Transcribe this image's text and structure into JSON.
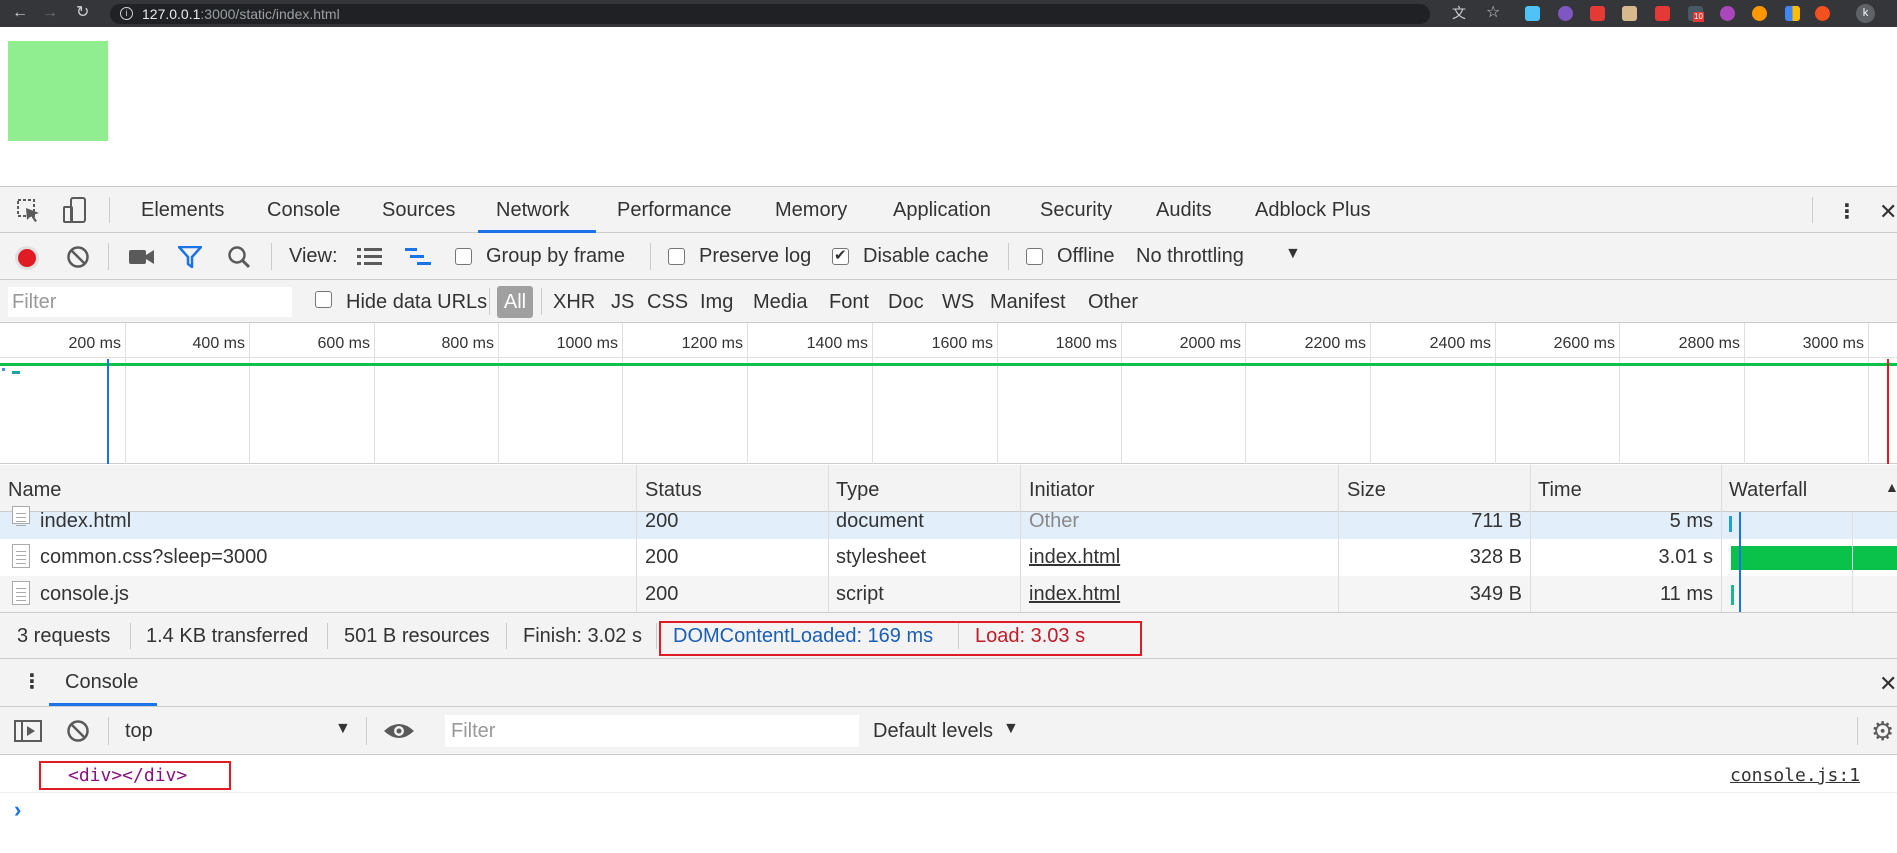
{
  "browser": {
    "url_host": "127.0.0.1",
    "url_path": ":3000/static/index.html",
    "profile_initial": "k",
    "extension_badge": "10"
  },
  "devtools": {
    "tabs": [
      "Elements",
      "Console",
      "Sources",
      "Network",
      "Performance",
      "Memory",
      "Application",
      "Security",
      "Audits",
      "Adblock Plus"
    ],
    "active_tab": "Network",
    "toolbar": {
      "view_label": "View:",
      "group_by_frame": "Group by frame",
      "preserve_log": "Preserve log",
      "disable_cache": "Disable cache",
      "offline": "Offline",
      "throttling": "No throttling"
    },
    "filterbar": {
      "placeholder": "Filter",
      "hide_data_urls": "Hide data URLs",
      "types": [
        "All",
        "XHR",
        "JS",
        "CSS",
        "Img",
        "Media",
        "Font",
        "Doc",
        "WS",
        "Manifest",
        "Other"
      ]
    },
    "timeline_ticks": [
      "200 ms",
      "400 ms",
      "600 ms",
      "800 ms",
      "1000 ms",
      "1200 ms",
      "1400 ms",
      "1600 ms",
      "1800 ms",
      "2000 ms",
      "2200 ms",
      "2400 ms",
      "2600 ms",
      "2800 ms",
      "3000 ms"
    ],
    "table": {
      "columns": [
        "Name",
        "Status",
        "Type",
        "Initiator",
        "Size",
        "Time",
        "Waterfall"
      ],
      "rows": [
        {
          "name": "index.html",
          "status": "200",
          "type": "document",
          "initiator": "Other",
          "size": "711 B",
          "time": "5 ms"
        },
        {
          "name": "common.css?sleep=3000",
          "status": "200",
          "type": "stylesheet",
          "initiator": "index.html",
          "size": "328 B",
          "time": "3.01 s"
        },
        {
          "name": "console.js",
          "status": "200",
          "type": "script",
          "initiator": "index.html",
          "size": "349 B",
          "time": "11 ms"
        }
      ]
    },
    "summary": {
      "requests": "3 requests",
      "transferred": "1.4 KB transferred",
      "resources": "501 B resources",
      "finish": "Finish: 3.02 s",
      "dom_content_loaded": "DOMContentLoaded: 169 ms",
      "load": "Load: 3.03 s"
    },
    "drawer": {
      "tab": "Console",
      "context": "top",
      "filter_placeholder": "Filter",
      "levels": "Default levels",
      "message": "<div></div>",
      "source": "console.js:1",
      "prompt": "›"
    },
    "colors": {
      "accent": "#1a73e8",
      "record": "#e01b24",
      "dcl": "#1a5fb4",
      "load": "#c01c28",
      "waterfall_bar": "#0ac24a"
    }
  }
}
